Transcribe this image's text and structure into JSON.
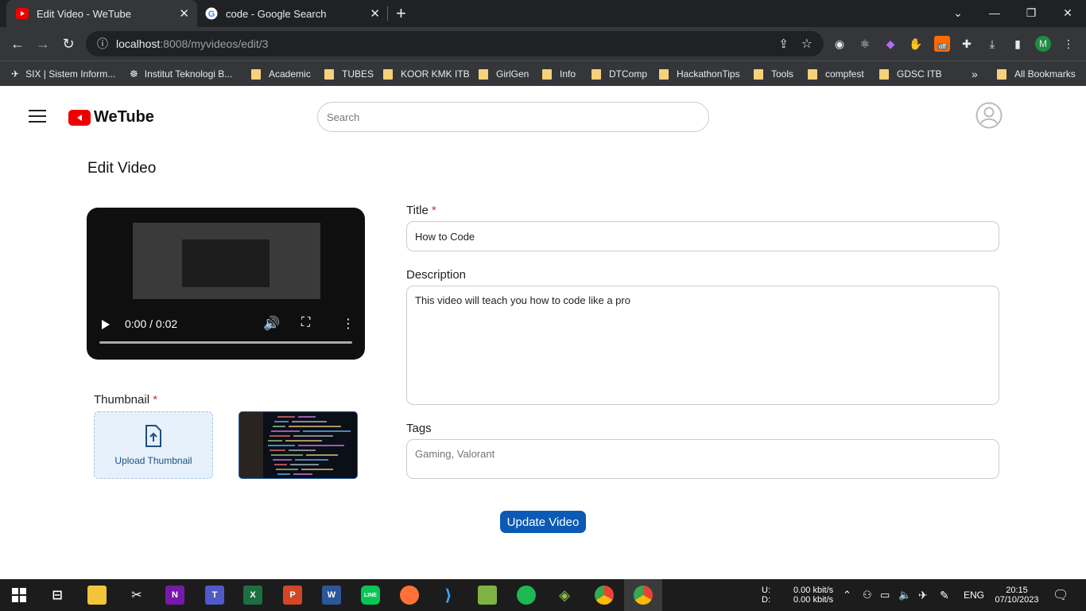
{
  "browser": {
    "tabs": [
      {
        "title": "Edit Video - WeTube"
      },
      {
        "title": "code - Google Search"
      }
    ],
    "url": {
      "host": "localhost",
      "path": ":8008/myvideos/edit/3"
    },
    "profile_initial": "M",
    "ext_off_badge": "off",
    "bookmarks": [
      "SIX | Sistem Inform...",
      "Institut Teknologi B...",
      "Academic",
      "TUBES",
      "KOOR KMK ITB",
      "GirlGen",
      "Info",
      "DTComp",
      "HackathonTips",
      "Tools",
      "compfest",
      "GDSC ITB"
    ],
    "overflow": "»",
    "all_bookmarks": "All Bookmarks"
  },
  "app": {
    "brand": "WeTube",
    "search_placeholder": "Search"
  },
  "page": {
    "heading": "Edit Video",
    "video": {
      "time": "0:00 / 0:02"
    },
    "thumbnail": {
      "label": "Thumbnail",
      "required_mark": "*",
      "upload_label": "Upload Thumbnail"
    },
    "title": {
      "label": "Title",
      "required_mark": "*",
      "value": "How to Code"
    },
    "description": {
      "label": "Description",
      "value": "This video will teach you how to code like a pro"
    },
    "tags": {
      "label": "Tags",
      "placeholder": "Gaming, Valorant"
    },
    "update_button": "Update Video"
  },
  "taskbar": {
    "net_labels": [
      "U:",
      "D:"
    ],
    "net_values": [
      "0.00 kbit/s",
      "0.00 kbit/s"
    ],
    "lang": "ENG",
    "time": "20:15",
    "date": "07/10/2023"
  },
  "colors": {
    "brand_red": "#ee0000",
    "accent_blue": "#0b5ab5",
    "required_red": "#d32f2f"
  }
}
